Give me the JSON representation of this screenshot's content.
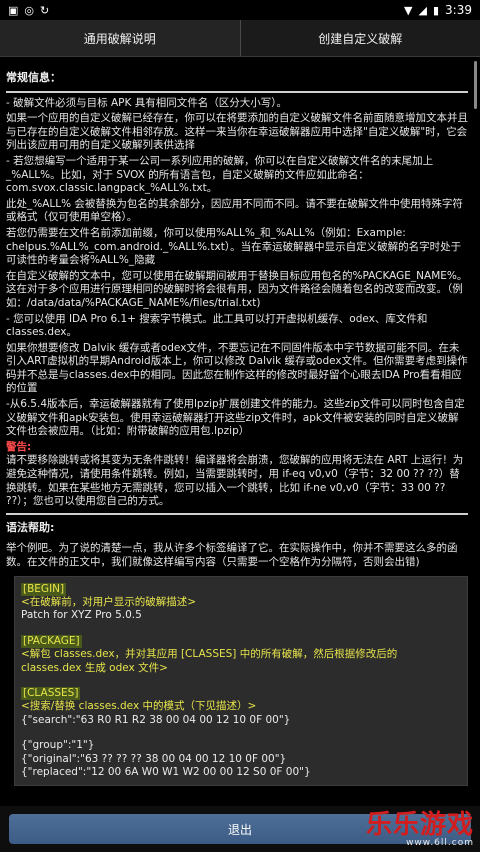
{
  "status_bar": {
    "time": "3:39",
    "left_icons": [
      "media-icon",
      "gamepad-icon",
      "sync-icon"
    ],
    "right_icons": [
      "wifi-icon",
      "signal-icon",
      "battery-icon"
    ]
  },
  "tabs": [
    {
      "label": "通用破解说明",
      "active": true
    },
    {
      "label": "创建自定义破解",
      "active": false
    }
  ],
  "general": {
    "title": "常规信息：",
    "p1": "- 破解文件必须与目标 APK 具有相同文件名（区分大小写）。",
    "p2": "如果一个应用的自定义破解已经存在，你可以在将要添加的自定义破解文件名前面随意增加文本并且与已存在的自定义破解文件相邻存放。这样一来当你在幸运破解器应用中选择\"自定义破解\"时，它会列出该应用可用的自定义破解列表供选择",
    "p3": "- 若您想编写一个适用于某一公司一系列应用的破解，你可以在自定义破解文件名的末尾加上 _%ALL%。比如，对于 SVOX 的所有语言包，自定义破解的文件应如此命名：com.svox.classic.langpack_%ALL%.txt。",
    "p4": "此处_%ALL% 会被替换为包名的其余部分，因应用不同而不同。请不要在破解文件中使用特殊字符或格式（仅可使用单空格）。",
    "p5": "若您仍需要在文件名前添加前缀，你可以使用%ALL%_和_%ALL%（例如：Example: chelpus.%ALL%_com.android._%ALL%.txt）。当在幸运破解器中显示自定义破解的名字时处于可读性的考量会将%ALL%_隐藏",
    "p6": "在自定义破解的文本中，您可以使用在破解期间被用于替换目标应用包名的%PACKAGE_NAME%。这在对于多个应用进行原理相同的破解时将会很有用，因为文件路径会随着包名的改变而改变。（例如：/data/data/%PACKAGE_NAME%/files/trial.txt)",
    "p7": "- 您可以使用 IDA Pro 6.1+ 搜索字节模式。此工具可以打开虚拟机缓存、odex、库文件和 classes.dex。",
    "p8": "如果你想要修改 Dalvik 缓存或者odex文件，不要忘记在不同固件版本中字节数据可能不同。在未引入ART虚拟机的早期Android版本上，你可以修改 Dalvik 缓存或odex文件。但你需要考虑到操作码并不总是与classes.dex中的相同。因此您在制作这样的修改时最好留个心眼去IDA Pro看看相应的位置",
    "p9": "-从6.5.4版本后，幸运破解器就有了使用lpzip扩展创建文件的能力。这些zip文件可以同时包含自定义破解文件和apk安装包。使用幸运破解器打开这些zip文件时，apk文件被安装的同时自定义破解文件也会被应用。（比如：附带破解的应用包.lpzip）",
    "warning_title": "警告:",
    "warning_text": "请不要移除跳转或将其变为无条件跳转！编译器将会崩溃，您破解的应用将无法在 ART 上运行！为避免这种情况，请使用条件跳转。例如，当需要跳转时，用 if-eq v0,v0（字节：32 00 ?? ??）替换跳转。如果在某些地方无需跳转，您可以插入一个跳转，比如 if-ne v0,v0（字节：33 00 ?? ??）；您也可以使用您自己的方式。"
  },
  "syntax": {
    "title": "语法帮助:",
    "intro": "举个例吧。为了说的清楚一点，我从许多个标签编译了它。在实际操作中，你并不需要这么多的函数。在文件的正文中，我们就像这样编写内容（只需要一个空格作为分隔符，否则会出错)",
    "begin_tag": "[BEGIN]",
    "begin_desc": "<在破解前，对用户显示的破解描述>",
    "begin_value": "Patch for XYZ Pro 5.0.5",
    "package_tag": "[PACKAGE]",
    "package_desc": "<解包 classes.dex，并对其应用 [CLASSES] 中的所有破解，然后根据修改后的 classes.dex 生成 odex 文件>",
    "classes_tag": "[CLASSES]",
    "classes_desc": "<搜索/替换 classes.dex 中的模式（下见描述）>",
    "line1": "{\"search\":\"63 R0 R1 R2 38 00 04 00 12 10 0F 00\"}",
    "line2": "{\"group\":\"1\"}",
    "line3": "{\"original\":\"63 ?? ?? ?? 38 00 04 00 12 10 0F 00\"}",
    "line4": "{\"replaced\":\"12 00 6A W0 W1 W2 00 00 12 S0 0F 00\"}"
  },
  "bottom": {
    "exit_label": "退出"
  },
  "watermark": {
    "text": "乐乐游戏",
    "url": "www.6ll.com"
  }
}
